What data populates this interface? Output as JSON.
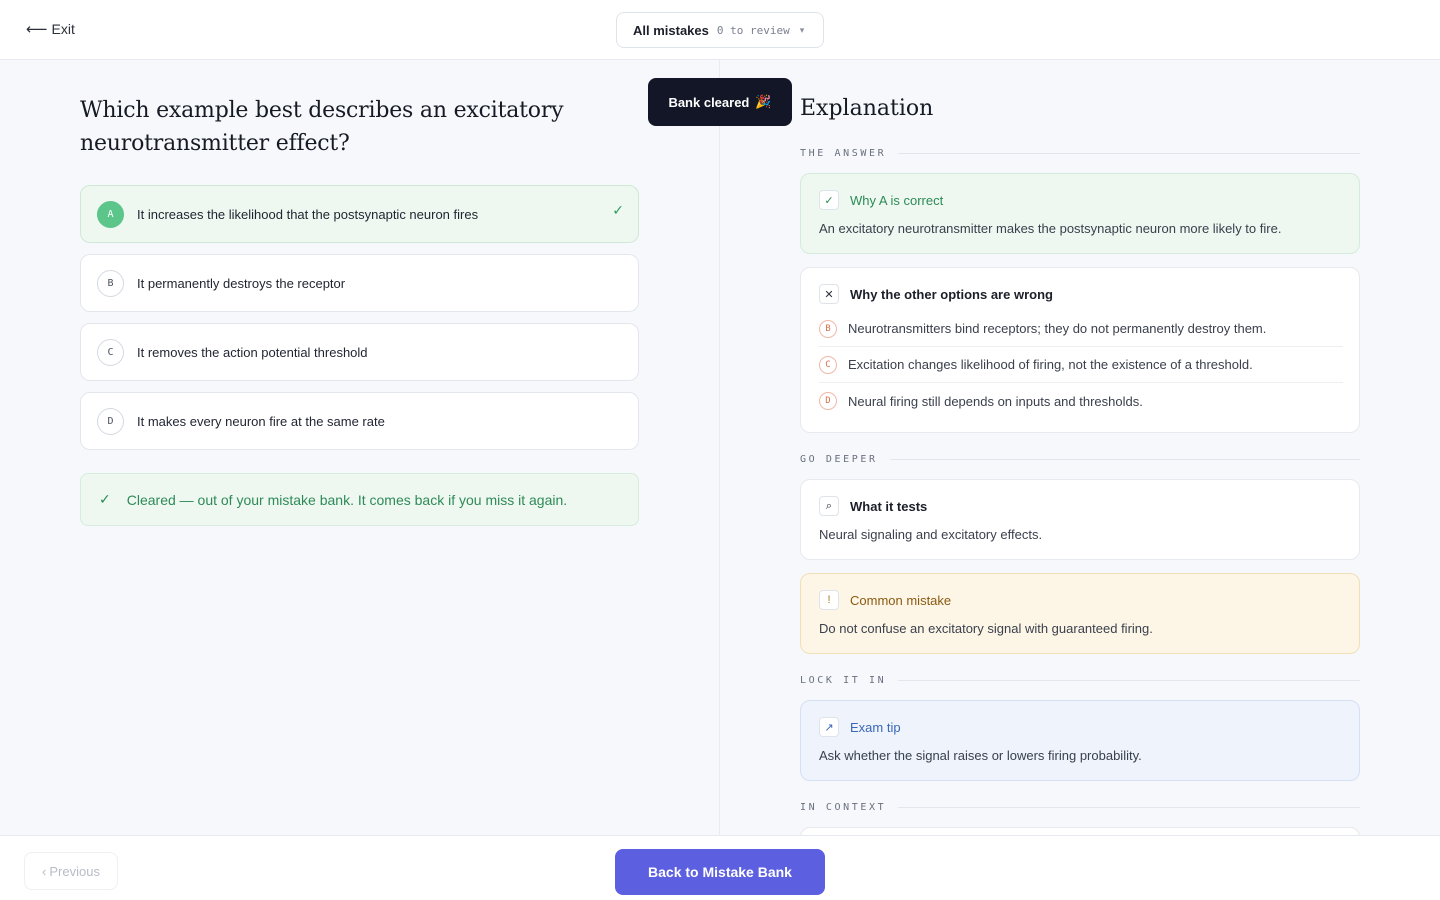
{
  "topbar": {
    "exit_icon": "arrow-left-icon",
    "exit_label": "Exit",
    "mode": {
      "title": "All mistakes",
      "count": "0 to review",
      "chevron": "▾"
    }
  },
  "toast": {
    "label": "Bank cleared",
    "emoji": "🎉"
  },
  "question": {
    "text": "Which example best describes an excitatory neurotransmitter effect?",
    "options": [
      {
        "letter": "A",
        "text": "It increases the likelihood that the postsynaptic neuron fires",
        "state": "correct",
        "check": "✓"
      },
      {
        "letter": "B",
        "text": "It permanently destroys the receptor"
      },
      {
        "letter": "C",
        "text": "It removes the action potential threshold"
      },
      {
        "letter": "D",
        "text": "It makes every neuron fire at the same rate"
      }
    ],
    "cleared": {
      "icon": "✓",
      "message": "Cleared — out of your mistake bank. It comes back if you miss it again."
    }
  },
  "explanation": {
    "title": "Explanation",
    "sections": {
      "answer": "THE ANSWER",
      "deeper": "GO DEEPER",
      "lock": "LOCK IT IN",
      "context": "IN CONTEXT"
    },
    "why_correct": {
      "icon": "✓",
      "title": "Why A is correct",
      "body": "An excitatory neurotransmitter makes the postsynaptic neuron more likely to fire."
    },
    "why_wrong": {
      "icon": "✕",
      "title": "Why the other options are wrong",
      "items": [
        {
          "letter": "B",
          "text": "Neurotransmitters bind receptors; they do not permanently destroy them."
        },
        {
          "letter": "C",
          "text": "Excitation changes likelihood of firing, not the existence of a threshold."
        },
        {
          "letter": "D",
          "text": "Neural firing still depends on inputs and thresholds."
        }
      ]
    },
    "tests": {
      "icon": "⌕",
      "title": "What it tests",
      "body": "Neural signaling and excitatory effects."
    },
    "common_mistake": {
      "icon": "!",
      "title": "Common mistake",
      "body": "Do not confuse an excitatory signal with guaranteed firing."
    },
    "exam_tip": {
      "icon": "↗",
      "title": "Exam tip",
      "body": "Ask whether the signal raises or lowers firing probability."
    }
  },
  "bottombar": {
    "previous_label": "Previous",
    "previous_icon": "‹",
    "back_label": "Back to Mistake Bank"
  },
  "colors": {
    "accent": "#5b5fe0",
    "correct": "#5cc58a",
    "toast_bg": "#121626",
    "warning_bg": "#fdf6e7",
    "tip_bg": "#eef3fc"
  }
}
